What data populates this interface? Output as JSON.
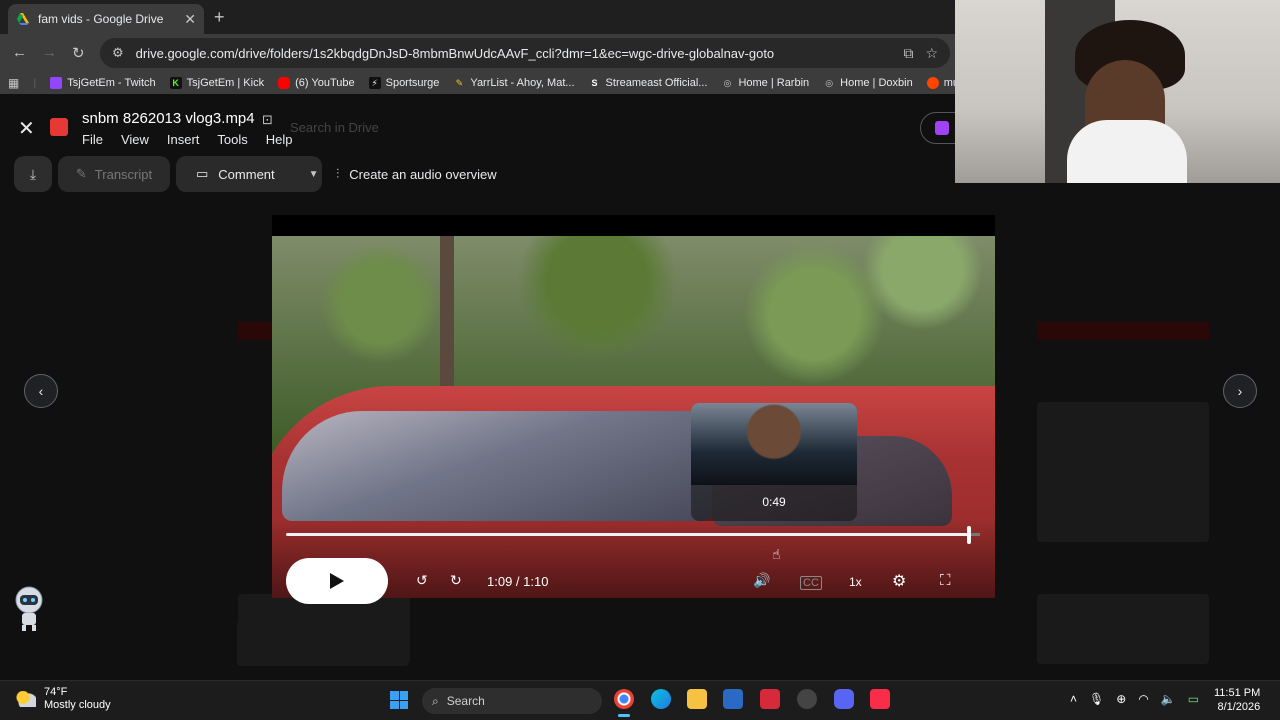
{
  "browser": {
    "tab_title": "fam vids - Google Drive",
    "url": "drive.google.com/drive/folders/1s2kbqdgDnJsD-8mbmBnwUdcAAvF_ccli?dmr=1&ec=wgc-drive-globalnav-goto",
    "bookmarks": [
      {
        "label": "TsjGetEm - Twitch",
        "icon": "twitch-icon",
        "color": "#9146ff"
      },
      {
        "label": "TsjGetEm | Kick",
        "icon": "kick-icon",
        "color": "#53fc18"
      },
      {
        "label": "(6) YouTube",
        "icon": "youtube-icon",
        "color": "#ff0000"
      },
      {
        "label": "Sportsurge",
        "icon": "sportsurge-icon",
        "color": "#1a1a1a"
      },
      {
        "label": "YarrList - Ahoy, Mat...",
        "icon": "yarr-icon",
        "color": "#f5c518"
      },
      {
        "label": "Streameast Official...",
        "icon": "streameast-icon",
        "color": "#ffffff"
      },
      {
        "label": "Home | Rarbin",
        "icon": "globe-icon",
        "color": "#c4c7c5"
      },
      {
        "label": "Home | Doxbin",
        "icon": "globe-icon",
        "color": "#c4c7c5"
      },
      {
        "label": "muhnpace",
        "icon": "reddit-icon",
        "color": "#ff4500"
      }
    ]
  },
  "viewer": {
    "filename": "snbm 8262013 vlog3.mp4",
    "menu": [
      "File",
      "View",
      "Insert",
      "Tools",
      "Help"
    ],
    "search_placeholder": "Search in Drive",
    "transcript_label": "Transcript",
    "comment_label": "Comment",
    "audio_overview_label": "Create an audio overview"
  },
  "player": {
    "preview_time": "0:49",
    "timecode": "1:09 / 1:10",
    "speed": "1x",
    "progress": 0.986
  },
  "taskbar": {
    "temperature": "74°F",
    "condition": "Mostly cloudy",
    "search_label": "Search",
    "time": "11:51 PM",
    "date": "8/1/2026"
  },
  "colors": {
    "accent": "#4cc2ff",
    "video_icon": "#e53935"
  }
}
